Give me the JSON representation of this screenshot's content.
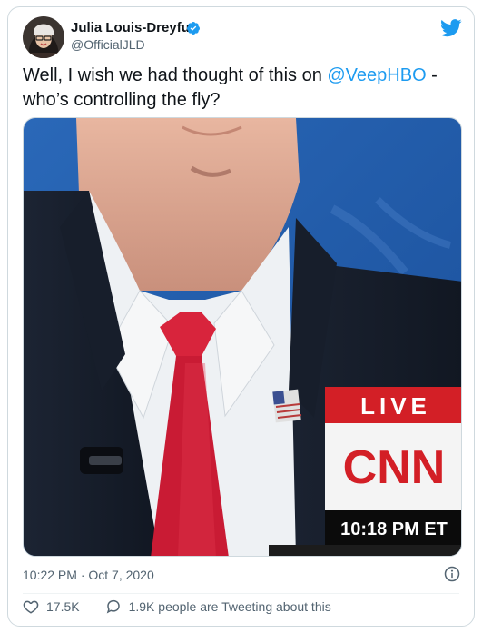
{
  "tweet": {
    "author_name": "Julia Louis-Dreyfus",
    "author_handle": "@OfficialJLD",
    "text_before": "Well, I wish we had thought of this on ",
    "mention": "@VeepHBO",
    "text_after": " - who’s controlling the fly?",
    "timestamp": "10:22 PM · Oct 7, 2020",
    "likes": "17.5K",
    "tweeting_text": "1.9K people are Tweeting about this"
  },
  "media": {
    "live_label": "LIVE",
    "network_logo": "CNN",
    "broadcast_time": "10:18 PM ET"
  },
  "colors": {
    "accent": "#1d9bf0",
    "secondary_text": "#536471",
    "cnn_red": "#d31f26"
  },
  "icons": [
    "verified-badge-icon",
    "twitter-bird-icon",
    "info-icon",
    "heart-icon",
    "reply-bubble-icon"
  ]
}
